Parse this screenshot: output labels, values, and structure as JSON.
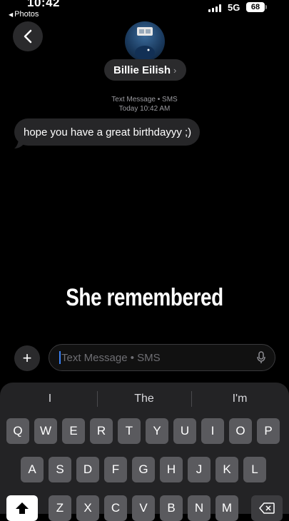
{
  "status_bar": {
    "time": "10:42",
    "back_app": "Photos",
    "network": "5G",
    "battery": "68"
  },
  "header": {
    "contact_name": "Billie Eilish",
    "chevron": "›"
  },
  "thread": {
    "service": "Text Message • SMS",
    "timestamp": "Today 10:42 AM",
    "messages": [
      {
        "text": "hope you have a great birthdayyy ;)",
        "direction": "incoming"
      }
    ]
  },
  "caption": "She remembered",
  "composer": {
    "placeholder": "Text Message • SMS",
    "plus_label": "+"
  },
  "keyboard": {
    "suggestions": [
      "I",
      "The",
      "I'm"
    ],
    "row1": [
      "Q",
      "W",
      "E",
      "R",
      "T",
      "Y",
      "U",
      "I",
      "O",
      "P"
    ],
    "row2": [
      "A",
      "S",
      "D",
      "F",
      "G",
      "H",
      "J",
      "K",
      "L"
    ],
    "row3": [
      "Z",
      "X",
      "C",
      "V",
      "B",
      "N",
      "M"
    ]
  },
  "colors": {
    "background": "#000000",
    "bubble": "#262628",
    "keyboard": "#232325",
    "key": "#5a5a5e",
    "caret": "#3b82f6"
  }
}
